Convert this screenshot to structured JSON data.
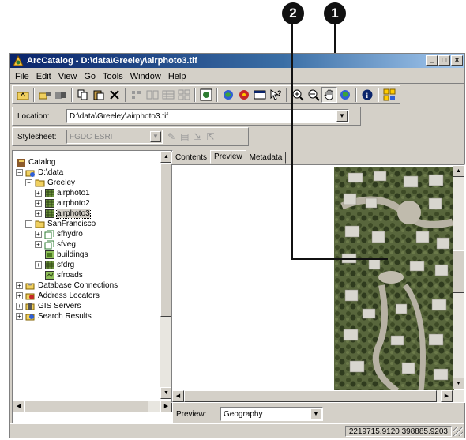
{
  "callouts": {
    "one": "1",
    "two": "2"
  },
  "window": {
    "title": "ArcCatalog - D:\\data\\Greeley\\airphoto3.tif",
    "controls": {
      "minimize": "_",
      "maximize": "□",
      "close": "×"
    }
  },
  "menu": [
    "File",
    "Edit",
    "View",
    "Go",
    "Tools",
    "Window",
    "Help"
  ],
  "location": {
    "label": "Location:",
    "value": "D:\\data\\Greeley\\airphoto3.tif"
  },
  "stylesheet": {
    "label": "Stylesheet:",
    "value": "FGDC ESRI"
  },
  "catalog_close": "×",
  "tree": [
    {
      "label": "Catalog",
      "icon": "catalog-icon"
    },
    {
      "label": "D:\\data",
      "icon": "drive-folder-icon",
      "expander": "−"
    },
    {
      "label": "Greeley",
      "icon": "folder-icon",
      "expander": "−"
    },
    {
      "label": "airphoto1",
      "icon": "raster-icon",
      "expander": "+"
    },
    {
      "label": "airphoto2",
      "icon": "raster-icon",
      "expander": "+"
    },
    {
      "label": "airphoto3",
      "icon": "raster-icon",
      "expander": "+",
      "selected": true
    },
    {
      "label": "SanFrancisco",
      "icon": "folder-icon",
      "expander": "−"
    },
    {
      "label": "sfhydro",
      "icon": "coverage-icon",
      "expander": "+"
    },
    {
      "label": "sfveg",
      "icon": "coverage-icon",
      "expander": "+"
    },
    {
      "label": "buildings",
      "icon": "shapefile-icon"
    },
    {
      "label": "sfdrg",
      "icon": "raster-icon",
      "expander": "+"
    },
    {
      "label": "sfroads",
      "icon": "shapefile-icon"
    },
    {
      "label": "Database Connections",
      "icon": "database-icon",
      "expander": "+"
    },
    {
      "label": "Address Locators",
      "icon": "address-locator-icon",
      "expander": "+"
    },
    {
      "label": "GIS Servers",
      "icon": "gis-server-icon",
      "expander": "+"
    },
    {
      "label": "Search Results",
      "icon": "search-results-icon",
      "expander": "+"
    }
  ],
  "tabs": [
    {
      "label": "Contents"
    },
    {
      "label": "Preview",
      "active": true
    },
    {
      "label": "Metadata"
    }
  ],
  "preview": {
    "label": "Preview:",
    "mode": "Geography"
  },
  "status": {
    "coordinates": "2219715.9120  398885.9203"
  }
}
